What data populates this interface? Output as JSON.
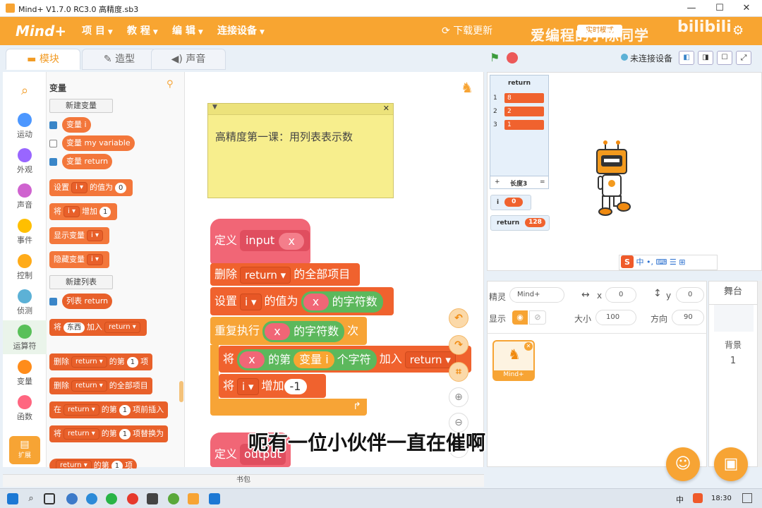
{
  "window": {
    "title": "Mind+ V1.7.0 RC3.0   高精度.sb3",
    "min": "—",
    "max": "☐",
    "close": "✕"
  },
  "menubar": {
    "brand": "Mind+",
    "items": [
      "项 目",
      "教 程",
      "编 辑",
      "连接设备"
    ],
    "download": "下载更新",
    "mode_btn": "实时模式",
    "watermark": "爱编程的小陈同学",
    "watermark_site": "bilibili"
  },
  "tabs": [
    {
      "label": "模块",
      "icon": "blocks-icon"
    },
    {
      "label": "造型",
      "icon": "brush-icon"
    },
    {
      "label": "声音",
      "icon": "speaker-icon"
    }
  ],
  "stage_bar": {
    "status": "未连接设备"
  },
  "categories": [
    {
      "label": "运动",
      "color": "#4c97ff"
    },
    {
      "label": "外观",
      "color": "#9966ff"
    },
    {
      "label": "声音",
      "color": "#cf63cf"
    },
    {
      "label": "事件",
      "color": "#ffbf00"
    },
    {
      "label": "控制",
      "color": "#ffab19"
    },
    {
      "label": "侦测",
      "color": "#5cb1d6"
    },
    {
      "label": "运算符",
      "color": "#59c059"
    },
    {
      "label": "变量",
      "color": "#ff8c1a"
    },
    {
      "label": "函数",
      "color": "#ff6680"
    }
  ],
  "extensions_label": "扩展",
  "palette": {
    "title": "变量",
    "new_variable": "新建变量",
    "var1": "变量 i",
    "var2": "变量 my variable",
    "var3": "变量 return",
    "set_a": "设置",
    "set_var": "i",
    "set_b": "的值为",
    "set_val": "0",
    "change_a": "将",
    "change_var": "i",
    "change_b": "增加",
    "change_val": "1",
    "show_a": "显示变量",
    "show_var": "i",
    "hide_a": "隐藏变量",
    "hide_var": "i",
    "new_list": "新建列表",
    "list1": "列表 return",
    "add_a": "将",
    "add_val": "东西",
    "add_b": "加入",
    "add_list": "return",
    "del_a": "删除",
    "del_list": "return",
    "del_b": "的第",
    "del_n": "1",
    "del_c": "项",
    "delall_a": "删除",
    "delall_list": "return",
    "delall_b": "的全部项目",
    "ins_a": "在",
    "ins_list": "return",
    "ins_b": "的第",
    "ins_n": "1",
    "ins_c": "项前插入",
    "rep_a": "将",
    "rep_list": "return",
    "rep_b": "的第",
    "rep_n": "1",
    "rep_c": "项替换为",
    "item_list": "return",
    "item_b": "的第",
    "item_n": "1",
    "item_c": "项"
  },
  "note": {
    "text": "高精度第一课：用列表表示数"
  },
  "script1": {
    "def": "定义",
    "name": "input",
    "param": "x",
    "l2a": "删除",
    "l2list": "return",
    "l2b": "的全部项目",
    "l3a": "设置",
    "l3var": "i",
    "l3b": "的值为",
    "l3x": "x",
    "l3c": "的字符数",
    "l4a": "重复执行",
    "l4x": "x",
    "l4b": "的字符数",
    "l4c": "次",
    "l5a": "将",
    "l5x": "x",
    "l5b": "的第",
    "l5var": "变量 i",
    "l5c": "个字符",
    "l5d": "加入",
    "l5list": "return",
    "l6a": "将",
    "l6var": "i",
    "l6b": "增加",
    "l6val": "-1"
  },
  "script2": {
    "def": "定义",
    "name": "output"
  },
  "list_monitor": {
    "title": "return",
    "items": [
      "8",
      "2",
      "1"
    ],
    "footer_add": "+",
    "footer_len": "长度3",
    "footer_eq": "="
  },
  "var_i": {
    "name": "i",
    "value": "0"
  },
  "var_return": {
    "name": "return",
    "value": "128"
  },
  "sprite_panel": {
    "sprite_label": "精灵",
    "sprite_name": "Mind+",
    "x_label": "x",
    "x_val": "0",
    "y_label": "y",
    "y_val": "0",
    "show_label": "显示",
    "size_label": "大小",
    "size_val": "100",
    "dir_label": "方向",
    "dir_val": "90",
    "thumb_name": "Mind+"
  },
  "stage_panel": {
    "title": "舞台",
    "bg_label": "背景",
    "bg_count": "1"
  },
  "ime": {
    "cn": "中"
  },
  "subtitle": "呃有一位小伙伴一直在催啊",
  "backpack": "书包",
  "taskbar": {
    "time": "18:30",
    "ime": "中"
  }
}
